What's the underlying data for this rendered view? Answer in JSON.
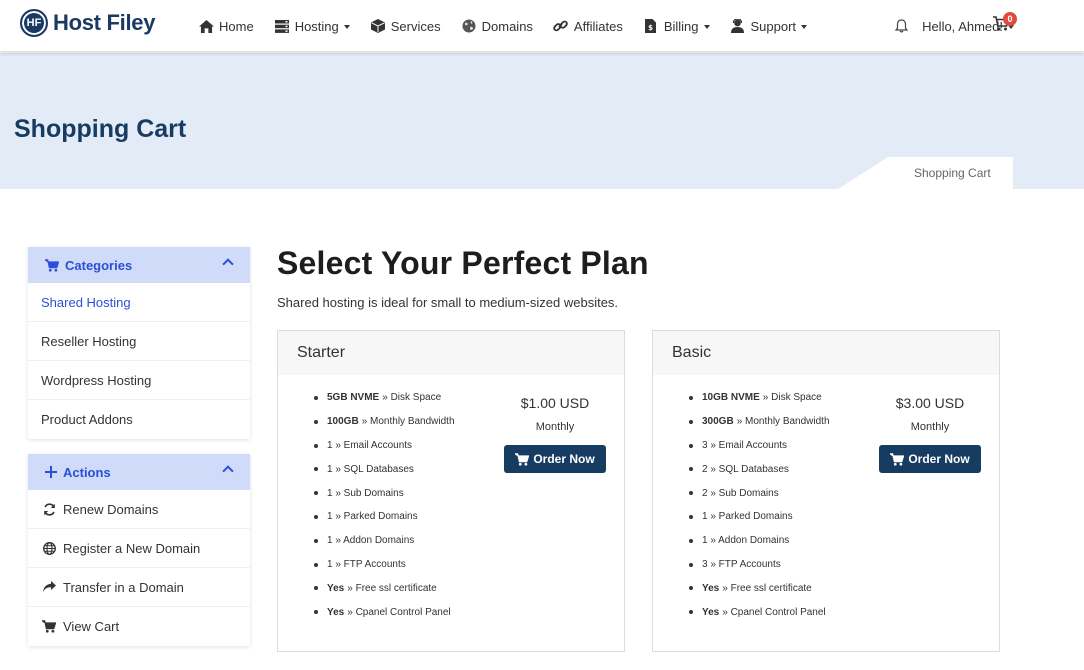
{
  "brand": {
    "logo_initials": "HF",
    "name": "Host Filey"
  },
  "nav": {
    "items": [
      {
        "label": "Home",
        "icon": "home-icon",
        "dropdown": false
      },
      {
        "label": "Hosting",
        "icon": "server-icon",
        "dropdown": true
      },
      {
        "label": "Services",
        "icon": "cube-icon",
        "dropdown": false
      },
      {
        "label": "Domains",
        "icon": "globe-icon",
        "dropdown": false
      },
      {
        "label": "Affiliates",
        "icon": "link-icon",
        "dropdown": false
      },
      {
        "label": "Billing",
        "icon": "invoice-icon",
        "dropdown": true
      },
      {
        "label": "Support",
        "icon": "support-icon",
        "dropdown": true
      }
    ],
    "user_greeting": "Hello, Ahmed!",
    "cart_count": "0"
  },
  "banner": {
    "title": "Shopping Cart",
    "breadcrumb": "Shopping Cart"
  },
  "sidebar": {
    "categories": {
      "title": "Categories",
      "items": [
        {
          "label": "Shared Hosting",
          "active": true
        },
        {
          "label": "Reseller Hosting",
          "active": false
        },
        {
          "label": "Wordpress Hosting",
          "active": false
        },
        {
          "label": "Product Addons",
          "active": false
        }
      ]
    },
    "actions": {
      "title": "Actions",
      "items": [
        {
          "label": "Renew Domains",
          "icon": "refresh-icon"
        },
        {
          "label": "Register a New Domain",
          "icon": "globe-icon"
        },
        {
          "label": "Transfer in a Domain",
          "icon": "share-icon"
        },
        {
          "label": "View Cart",
          "icon": "cart-icon"
        }
      ]
    }
  },
  "main": {
    "title": "Select Your Perfect Plan",
    "subtitle": "Shared hosting is ideal for small to medium-sized websites.",
    "plans": [
      {
        "name": "Starter",
        "price": "$1.00 USD",
        "cycle": "Monthly",
        "button": "Order Now",
        "features": [
          {
            "strong": "5GB NVME",
            "text": "» Disk Space"
          },
          {
            "strong": "100GB",
            "text": "» Monthly Bandwidth"
          },
          {
            "strong": "",
            "text": "1 » Email Accounts"
          },
          {
            "strong": "",
            "text": "1 » SQL Databases"
          },
          {
            "strong": "",
            "text": "1 » Sub Domains"
          },
          {
            "strong": "",
            "text": "1 » Parked Domains"
          },
          {
            "strong": "",
            "text": "1 » Addon Domains"
          },
          {
            "strong": "",
            "text": "1 » FTP Accounts"
          },
          {
            "strong": "Yes",
            "text": "» Free ssl certificate"
          },
          {
            "strong": "Yes",
            "text": "» Cpanel Control Panel"
          }
        ]
      },
      {
        "name": "Basic",
        "price": "$3.00 USD",
        "cycle": "Monthly",
        "button": "Order Now",
        "features": [
          {
            "strong": "10GB NVME",
            "text": "» Disk Space"
          },
          {
            "strong": "300GB",
            "text": "» Monthly Bandwidth"
          },
          {
            "strong": "",
            "text": "3 » Email Accounts"
          },
          {
            "strong": "",
            "text": "2 » SQL Databases"
          },
          {
            "strong": "",
            "text": "2 » Sub Domains"
          },
          {
            "strong": "",
            "text": "1 » Parked Domains"
          },
          {
            "strong": "",
            "text": "1 » Addon Domains"
          },
          {
            "strong": "",
            "text": "3 » FTP Accounts"
          },
          {
            "strong": "Yes",
            "text": "» Free ssl certificate"
          },
          {
            "strong": "Yes",
            "text": "» Cpanel Control Panel"
          }
        ]
      }
    ]
  },
  "colors": {
    "brand": "#173c62",
    "accent": "#2b4fd8",
    "banner_bg": "#e3ebf6",
    "panel_head_bg": "#d0dbfa",
    "badge": "#e04b3f"
  }
}
